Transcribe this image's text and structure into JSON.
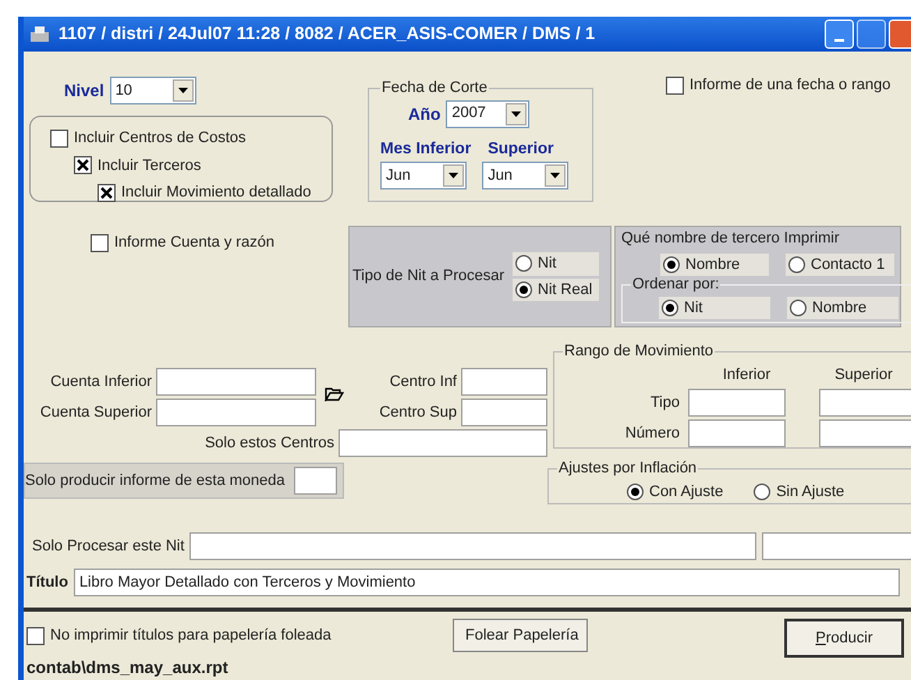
{
  "window": {
    "title": "1107 / distri / 24Jul07 11:28 / 8082 / ACER_ASIS-COMER / DMS / 1"
  },
  "nivel": {
    "label": "Nivel",
    "value": "10"
  },
  "costos": [
    {
      "label": "Incluir Centros de Costos",
      "checked": false,
      "children": [
        {
          "label": "Incluir Terceros",
          "checked": true,
          "children": [
            {
              "label": "Incluir Movimiento detallado",
              "checked": true
            }
          ]
        }
      ]
    }
  ],
  "fecha_corte": {
    "title": "Fecha de Corte",
    "ano_label": "Año",
    "ano_value": "2007",
    "mes_inferior_label": "Mes Inferior",
    "mes_inferior_value": "Jun",
    "superior_label": "Superior",
    "superior_value": "Jun"
  },
  "informe_rango": {
    "label": "Informe de una fecha o rango",
    "checked": false
  },
  "informe_cuenta": {
    "label": "Informe Cuenta y razón",
    "checked": false
  },
  "tipo_nit": {
    "label": "Tipo de Nit a Procesar",
    "options": [
      {
        "label": "Nit",
        "selected": false
      },
      {
        "label": "Nit Real",
        "selected": true
      }
    ]
  },
  "tercero": {
    "title": "Qué nombre de tercero Imprimir",
    "options": [
      {
        "label": "Nombre",
        "selected": true
      },
      {
        "label": "Contacto 1",
        "selected": false
      }
    ],
    "ordenar": {
      "title": "Ordenar por:",
      "options": [
        {
          "label": "Nit",
          "selected": true
        },
        {
          "label": "Nombre",
          "selected": false
        }
      ]
    }
  },
  "cuenta_fields": [
    {
      "label": "Cuenta Inferior"
    },
    {
      "label": "Cuenta Superior"
    }
  ],
  "centro_fields": [
    {
      "label": "Centro Inf"
    },
    {
      "label": "Centro Sup"
    }
  ],
  "solo_centros": {
    "label": "Solo estos Centros"
  },
  "rango": {
    "title": "Rango de Movimiento",
    "columns": [
      "Inferior",
      "Superior"
    ],
    "rows": [
      "Tipo",
      "Número"
    ]
  },
  "moneda": {
    "label": "Solo producir informe de esta moneda"
  },
  "ajustes": {
    "title": "Ajustes por Inflación",
    "options": [
      {
        "label": "Con Ajuste",
        "selected": true
      },
      {
        "label": "Sin Ajuste",
        "selected": false
      }
    ]
  },
  "nit": {
    "label": "Solo Procesar este Nit"
  },
  "titulo": {
    "label": "Título",
    "value": "Libro Mayor Detallado con Terceros y Movimiento"
  },
  "no_imprimir": {
    "label": "No imprimir títulos para papelería foleada",
    "checked": false
  },
  "buttons": [
    {
      "label": "Folear Papelería",
      "kind": "normal"
    },
    {
      "label": "Producir",
      "kind": "default"
    }
  ],
  "report_path": "contab\\dms_may_aux.rpt"
}
